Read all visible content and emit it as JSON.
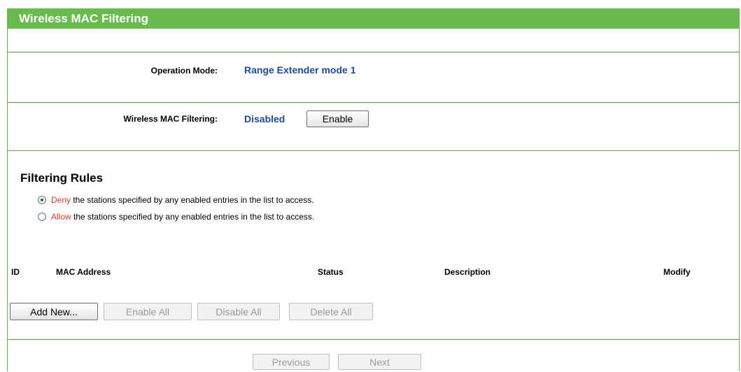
{
  "page": {
    "title": "Wireless MAC Filtering"
  },
  "operation_mode": {
    "label": "Operation Mode:",
    "value": "Range Extender mode 1"
  },
  "mac_filtering": {
    "label": "Wireless MAC Filtering:",
    "status": "Disabled",
    "toggle_button": "Enable"
  },
  "filtering_rules": {
    "title": "Filtering Rules",
    "deny": {
      "keyword": "Deny",
      "text": " the stations specified by any enabled entries in the list to access.",
      "checked": true
    },
    "allow": {
      "keyword": "Allow",
      "text": " the stations specified by any enabled entries in the list to access.",
      "checked": false
    }
  },
  "table": {
    "columns": [
      "ID",
      "MAC Address",
      "Status",
      "Description",
      "Modify"
    ],
    "rows": []
  },
  "actions": {
    "add_new": "Add New...",
    "enable_all": "Enable All",
    "disable_all": "Disable All",
    "delete_all": "Delete All"
  },
  "pagination": {
    "previous": "Previous",
    "next": "Next"
  },
  "colors": {
    "accent_green": "#69bb4e",
    "value_blue": "#1f4a94",
    "keyword_red": "#e03a2c"
  }
}
